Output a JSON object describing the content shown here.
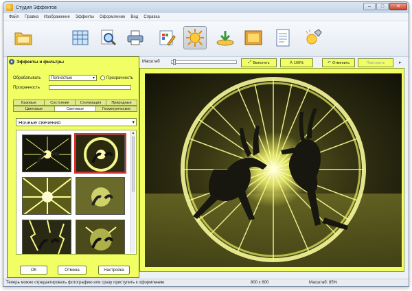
{
  "window": {
    "title": "Студия Эффектов",
    "close": "✕",
    "maximize": "□",
    "minimize": "–"
  },
  "menu": [
    "Файл",
    "Правка",
    "Изображение",
    "Эффекты",
    "Оформление",
    "Вид",
    "Справка"
  ],
  "toolbar": {
    "tools": [
      {
        "icon": "open-folder-icon"
      },
      {
        "icon": "grid-icon"
      },
      {
        "icon": "magnifier-icon"
      },
      {
        "icon": "printer-icon"
      },
      {
        "icon": "edit-palette-icon"
      },
      {
        "icon": "sun-effects-icon"
      },
      {
        "icon": "download-icon"
      },
      {
        "icon": "frame-icon"
      },
      {
        "icon": "document-icon"
      },
      {
        "icon": "sparkle-pencil-icon"
      }
    ]
  },
  "panel": {
    "title": "Эффекты и фильтры",
    "apply_label": "Обрабатывать",
    "apply_value": "Полностью",
    "transparency_checkbox": "Прозрачность",
    "opacity_label": "Прозрачность",
    "tabs_row1": [
      "Базовые",
      "Состояние",
      "Стилизация",
      "Природные"
    ],
    "tabs_row2": [
      "Цветовые",
      "Световые",
      "Геометрические"
    ],
    "selected_tab": "Световые",
    "effect_selected": "Ночные свечения",
    "ok": "ОК",
    "cancel": "Отмена",
    "settings": "Настройка"
  },
  "zoom": {
    "label": "Масштаб",
    "fit": "Вместить",
    "percent": "100%",
    "undo": "Отменить",
    "redo": "Повторить"
  },
  "status": {
    "message": "Теперь можно отредактировать фотографию или сразу приступить к оформлению",
    "size": "800 x 600",
    "zoom": "Масштаб: 85%"
  },
  "colors": {
    "accent_yellow": "#f1ff64",
    "glow": "#ffff70"
  }
}
